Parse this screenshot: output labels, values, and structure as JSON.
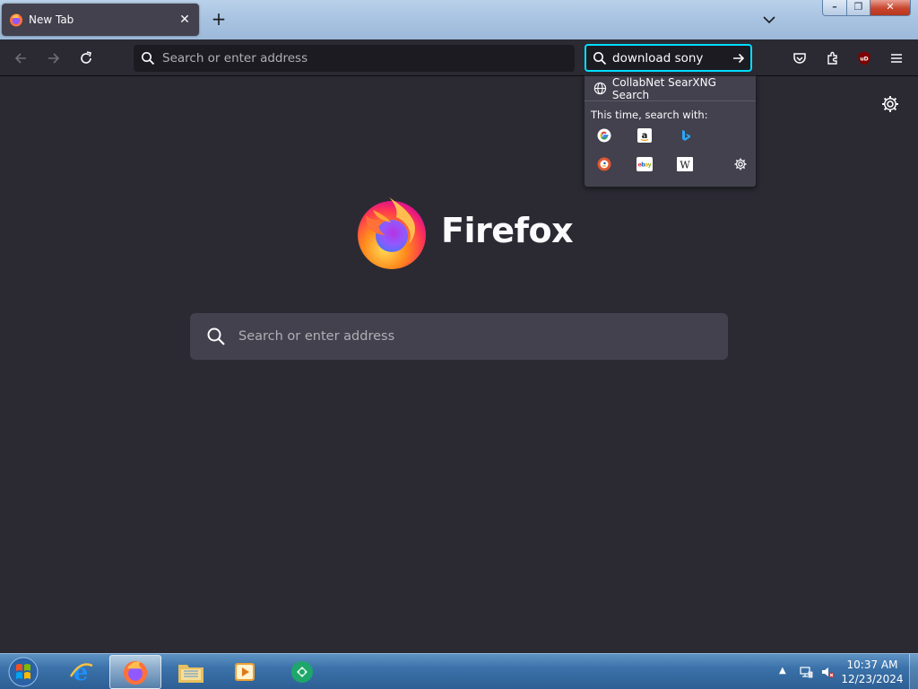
{
  "tabs": [
    {
      "title": "New Tab",
      "active": true
    }
  ],
  "nav": {
    "url_placeholder": "Search or enter address"
  },
  "searchbar": {
    "value": "download sony",
    "engine_label": "CollabNet SearXNG Search",
    "hint": "This time, search with:",
    "alt_engines": [
      "google-icon",
      "amazon-icon",
      "bing-icon",
      "duckduckgo-icon",
      "ebay-icon",
      "wikipedia-icon"
    ]
  },
  "content": {
    "wordmark": "Firefox",
    "search_placeholder": "Search or enter address"
  },
  "clock": {
    "time": "10:37 AM",
    "date": "12/23/2024"
  },
  "colors": {
    "accent_focus": "#00ddff",
    "page_bg": "#2b2a33",
    "panel_bg": "#42414d"
  }
}
